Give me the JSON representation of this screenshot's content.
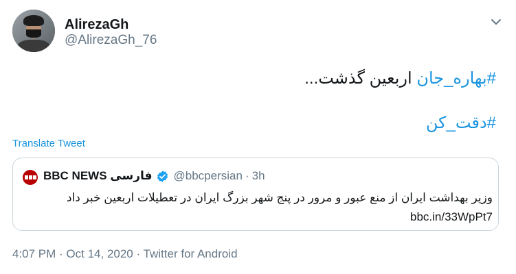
{
  "author": {
    "display_name": "AlirezaGh",
    "handle": "@AlirezaGh_76"
  },
  "tweet": {
    "line1_hashtag": "#بهاره_جان",
    "line1_text": " اربعین گذشت...",
    "line2_hashtag": "#دقت_کن"
  },
  "translate_label": "Translate Tweet",
  "quoted_tweet": {
    "name": "BBC NEWS فارسی",
    "handle": "@bbcpersian",
    "separator": "·",
    "time": "3h",
    "text": "وزیر بهداشت ایران از منع عبور و مرور در پنج شهر بزرگ ایران در تعطیلات اربعین خبر داد",
    "link": "bbc.in/33WpPt7"
  },
  "meta": {
    "text": "4:07 PM · Oct 14, 2020 · Twitter for Android"
  },
  "colors": {
    "link": "#1b95e0",
    "muted": "#657786",
    "bbc_red": "#b80000"
  },
  "icons": [
    "chevron-down-icon",
    "verified-badge-icon",
    "bbc-logo"
  ]
}
